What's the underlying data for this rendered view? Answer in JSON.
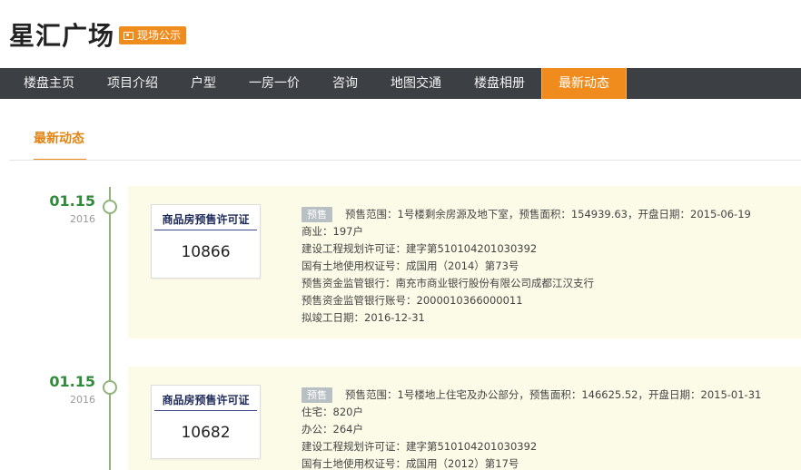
{
  "header": {
    "title": "星汇广场",
    "badge": "现场公示"
  },
  "nav": {
    "items": [
      "楼盘主页",
      "项目介绍",
      "户型",
      "一房一价",
      "咨询",
      "地图交通",
      "楼盘相册",
      "最新动态"
    ],
    "active_index": 7
  },
  "section": {
    "tab_label": "最新动态"
  },
  "colors": {
    "accent": "#f08c1e",
    "nav_bg": "#3c4044",
    "date": "#2f8a3a",
    "timeline": "#8fb37a",
    "card_bg": "#fcfbe8"
  },
  "entries": [
    {
      "date_md": "01.15",
      "date_year": "2016",
      "permit_title": "商品房预售许可证",
      "permit_number": "10866",
      "tag": "预售",
      "first_line": "预售范围：1号楼剩余房源及地下室，预售面积：154939.63，开盘日期：2015-06-19",
      "lines": [
        "商业：197户",
        "建设工程规划许可证：建字第510104201030392",
        "国有土地使用权证号：成国用（2014）第73号",
        "预售资金监管银行：南充市商业银行股份有限公司成都江汉支行",
        "预售资金监管银行账号：2000010366000011",
        "拟竣工日期：2016-12-31"
      ]
    },
    {
      "date_md": "01.15",
      "date_year": "2016",
      "permit_title": "商品房预售许可证",
      "permit_number": "10682",
      "tag": "预售",
      "first_line": "预售范围：1号楼地上住宅及办公部分，预售面积：146625.52，开盘日期：2015-01-31",
      "lines": [
        "住宅：820户",
        "办公：264户",
        "建设工程规划许可证：建字第510104201030392",
        "国有土地使用权证号：成国用（2012）第17号"
      ]
    }
  ]
}
